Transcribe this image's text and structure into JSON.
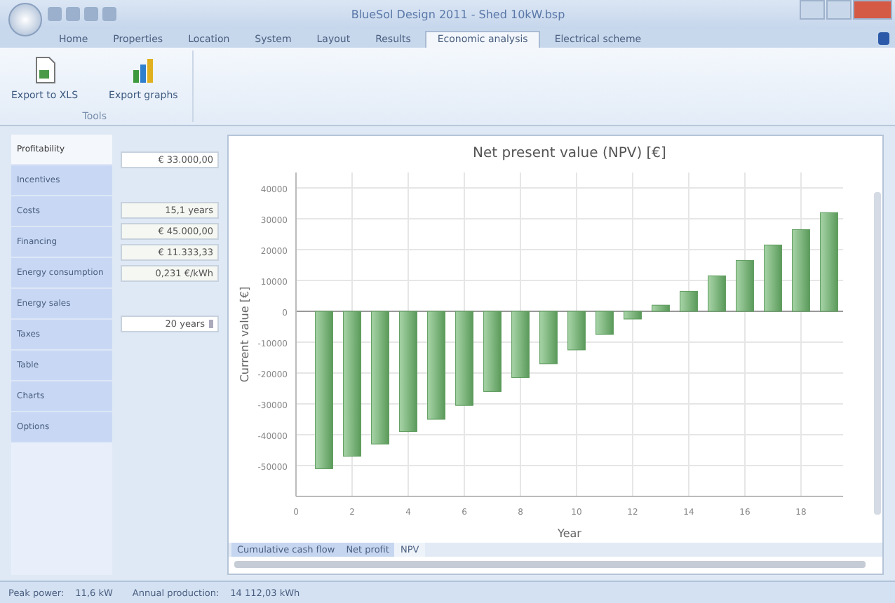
{
  "window": {
    "title": "BlueSol Design 2011 - Shed 10kW.bsp"
  },
  "ribbon_tabs": [
    {
      "label": "Home",
      "selected": false
    },
    {
      "label": "Properties",
      "selected": false
    },
    {
      "label": "Location",
      "selected": false
    },
    {
      "label": "System",
      "selected": false
    },
    {
      "label": "Layout",
      "selected": false
    },
    {
      "label": "Results",
      "selected": false
    },
    {
      "label": "Economic analysis",
      "selected": true
    },
    {
      "label": "Electrical scheme",
      "selected": false
    }
  ],
  "ribbon": {
    "buttons": [
      {
        "label": "Export to XLS",
        "kind": "xls"
      },
      {
        "label": "Export graphs",
        "kind": "graph"
      }
    ],
    "group_label": "Tools"
  },
  "sidebar": {
    "items": [
      {
        "label": "Profitability",
        "selected": true
      },
      {
        "label": "Incentives",
        "selected": false
      },
      {
        "label": "Costs",
        "selected": false
      },
      {
        "label": "Financing",
        "selected": false
      },
      {
        "label": "Energy consumption",
        "selected": false
      },
      {
        "label": "Energy sales",
        "selected": false
      },
      {
        "label": "Taxes",
        "selected": false
      },
      {
        "label": "Table",
        "selected": false
      },
      {
        "label": "Charts",
        "selected": false
      },
      {
        "label": "Options",
        "selected": false
      }
    ]
  },
  "fields": [
    {
      "value": "€ 33.000,00",
      "kind": "input"
    },
    {
      "kind": "gap"
    },
    {
      "value": "15,1 years",
      "kind": "output"
    },
    {
      "value": "€ 45.000,00",
      "kind": "output"
    },
    {
      "value": "€ 11.333,33",
      "kind": "output"
    },
    {
      "value": "0,231 €/kWh",
      "kind": "output"
    },
    {
      "kind": "gap"
    },
    {
      "value": "20 years",
      "kind": "select"
    }
  ],
  "chart": {
    "chart_data": {
      "type": "bar",
      "title": "Net present value (NPV) [€]",
      "xlabel": "Year",
      "ylabel": "Current value [€]",
      "x": [
        1,
        2,
        3,
        4,
        5,
        6,
        7,
        8,
        9,
        10,
        11,
        12,
        13,
        14,
        15,
        16,
        17,
        18,
        19
      ],
      "grid": true,
      "series": [
        {
          "color": "#5a9a5a",
          "values": [
            -51000,
            -47000,
            -43000,
            -39000,
            -35000,
            -30500,
            -26000,
            -21500,
            -17000,
            -12500,
            -7500,
            -2500,
            2000,
            6500,
            11500,
            16500,
            21500,
            26500,
            32000
          ]
        }
      ],
      "xlim": [
        0,
        19.5
      ],
      "ylim": [
        -60000,
        45000
      ],
      "xticks": [
        0,
        2,
        4,
        6,
        8,
        10,
        12,
        14,
        16,
        18
      ],
      "yticks": [
        -50000,
        -40000,
        -30000,
        -20000,
        -10000,
        0,
        10000,
        20000,
        30000,
        40000
      ]
    }
  },
  "chart_tabs": [
    {
      "label": "Cumulative cash flow",
      "selected": false
    },
    {
      "label": "Net profit",
      "selected": false
    },
    {
      "label": "NPV",
      "selected": true
    }
  ],
  "status_bar": [
    {
      "label": "Peak power:",
      "value": "11,6 kW"
    },
    {
      "label": "Annual production:",
      "value": "14 112,03 kWh"
    }
  ]
}
